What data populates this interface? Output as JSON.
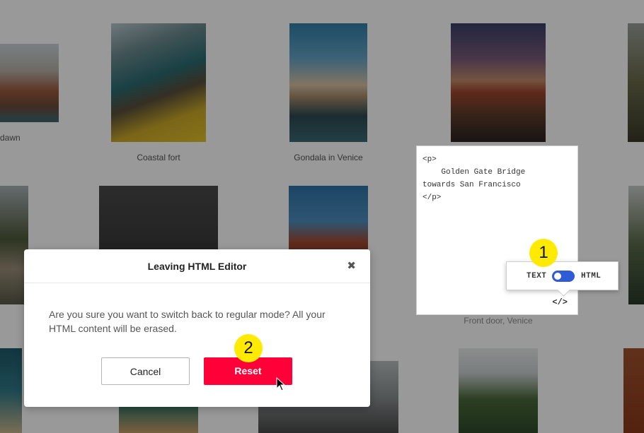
{
  "gallery": {
    "captions": {
      "dawn": "dawn",
      "coastal_fort": "Coastal fort",
      "gondola": "Gondala in Venice",
      "front_door": "Front door, Venice"
    }
  },
  "editor": {
    "code_lines": [
      "<p>",
      "    Golden Gate Bridge",
      "towards San Francisco",
      "</p>"
    ],
    "code_toggle_icon": "</>"
  },
  "toggle": {
    "text_label": "TEXT",
    "html_label": "HTML",
    "mode": "html"
  },
  "steps": {
    "one": "1",
    "two": "2"
  },
  "dialog": {
    "title": "Leaving HTML Editor",
    "close": "✖",
    "message": "Are you sure you want to switch back to regular mode? All your HTML content will be erased.",
    "cancel_label": "Cancel",
    "reset_label": "Reset"
  },
  "colors": {
    "accent_red": "#ff0038",
    "toggle_blue": "#2f5bd6",
    "step_yellow": "#ffea00"
  }
}
